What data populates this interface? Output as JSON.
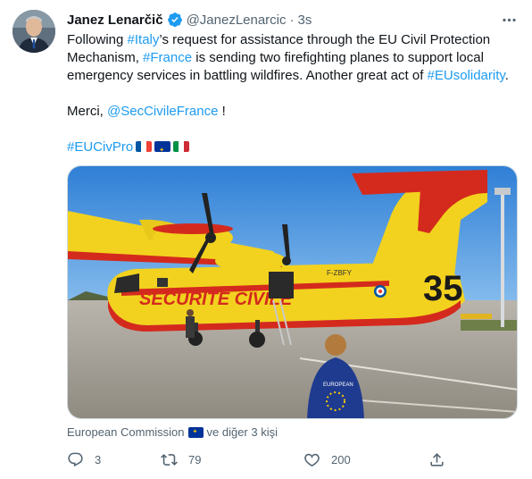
{
  "author": {
    "display_name": "Janez Lenarčič",
    "handle": "@JanezLenarcic",
    "separator": "·",
    "time": "3s"
  },
  "tweet": {
    "line1_prefix": "Following ",
    "tag_italy": "#Italy",
    "line1_rest": "’s request for assistance through the EU Civil Protection Mechanism, ",
    "tag_france": "#France",
    "line2_rest": " is sending two firefighting planes to support local emergency services in battling wildfires. Another great act of ",
    "tag_eusolidarity": "#EUsolidarity",
    "line3_end": ".",
    "merci": "Merci, ",
    "mention": "@SecCivileFrance",
    "merci_end": " !",
    "tag_eucivpro": "#EUCivPro"
  },
  "media": {
    "plane_registration": "F-ZBFY",
    "plane_number": "35",
    "plane_lettering": "SECURITE CIVILE",
    "vest_text": "EUROPEAN"
  },
  "liked_by": {
    "account": "European Commission",
    "rest": "ve diğer 3 kişi"
  },
  "actions": {
    "reply_count": "3",
    "retweet_count": "79",
    "like_count": "200"
  },
  "colors": {
    "accent": "#1d9bf0",
    "text": "#0f1419",
    "muted": "#536471"
  },
  "icons": [
    "more-icon",
    "verified-badge-icon",
    "reply-icon",
    "retweet-icon",
    "like-icon",
    "share-icon",
    "france-flag-icon",
    "eu-flag-icon",
    "italy-flag-icon"
  ]
}
